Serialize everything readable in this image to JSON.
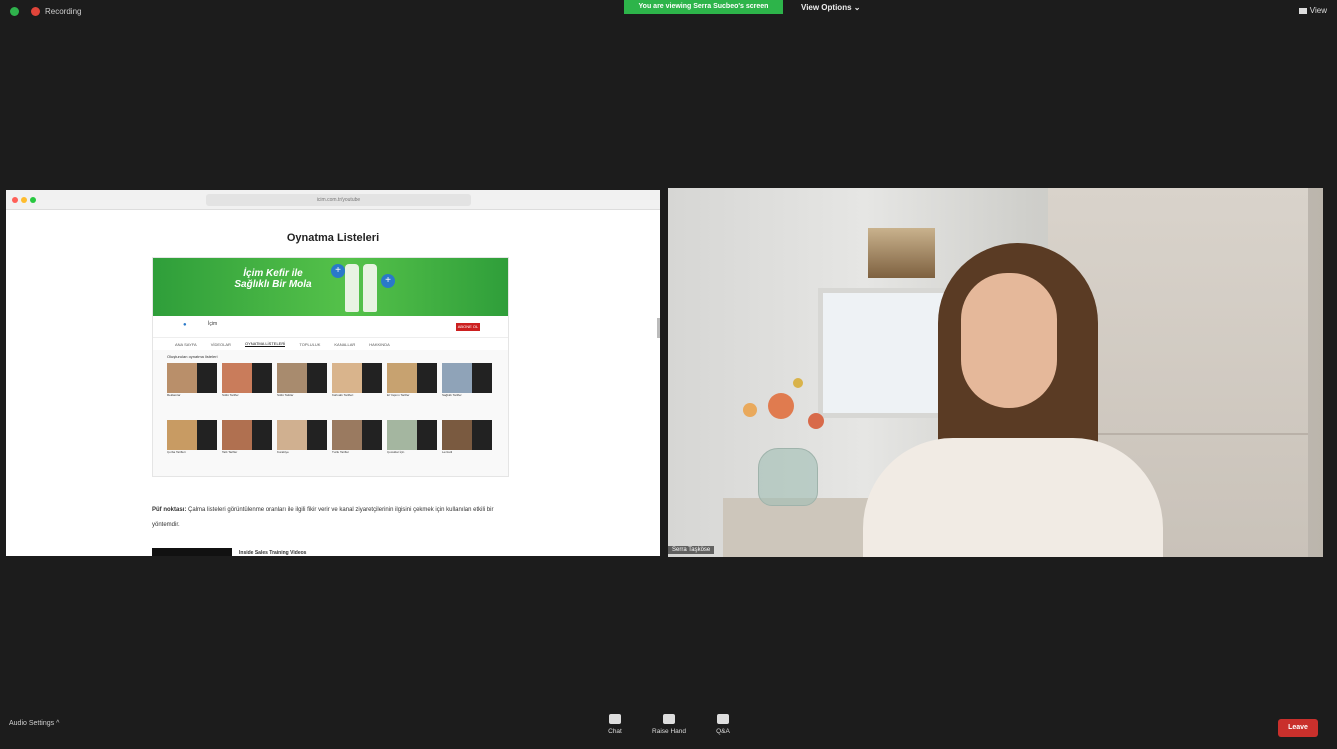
{
  "topbar": {
    "recording_label": "Recording",
    "viewing_banner": "You are viewing Serra Sucbeo's screen",
    "view_options": "View Options ⌄",
    "view_button": "View"
  },
  "shared_screen": {
    "url": "icim.com.tr/youtube",
    "page_title": "Oynatma Listeleri",
    "banner_text": "İçim Kefir ile Sağlıklı Bir Mola",
    "channel_name": "İçim",
    "subscribe": "ABONE OL",
    "tabs": [
      "ANA SAYFA",
      "VİDEOLAR",
      "OYNATMA LİSTELERİ",
      "TOPLULUK",
      "KANALLAR",
      "HAKKINDA"
    ],
    "section_label": "Oluşturulan oynatma listeleri",
    "playlists": [
      "Reklamlar",
      "Sütlü Tarifler",
      "Sütlü Tatlılar",
      "Kahvaltı Tarifleri",
      "El Yapımı Tarifler",
      "Sağlıklı Tarifler",
      "Çorba Tarifleri",
      "Tatlı Tarifler",
      "Kurabiye",
      "Tuzlu Tarifler",
      "Çocuklar İçin",
      "Lezzetli"
    ],
    "tip_bold": "Püf noktası:",
    "tip_text": "Çalma listeleri görüntülenme oranları ile ilgili fikir verir ve kanal ziyaretçilerinin ilgisini çekmek için kullanılan etkili bir yöntemdir.",
    "video_title": "Inside Sales Training Videos"
  },
  "camera": {
    "participant_name": "Serra Taşköse"
  },
  "bottombar": {
    "audio_settings": "Audio Settings ^",
    "chat": "Chat",
    "raise_hand": "Raise Hand",
    "qa": "Q&A",
    "leave": "Leave"
  }
}
